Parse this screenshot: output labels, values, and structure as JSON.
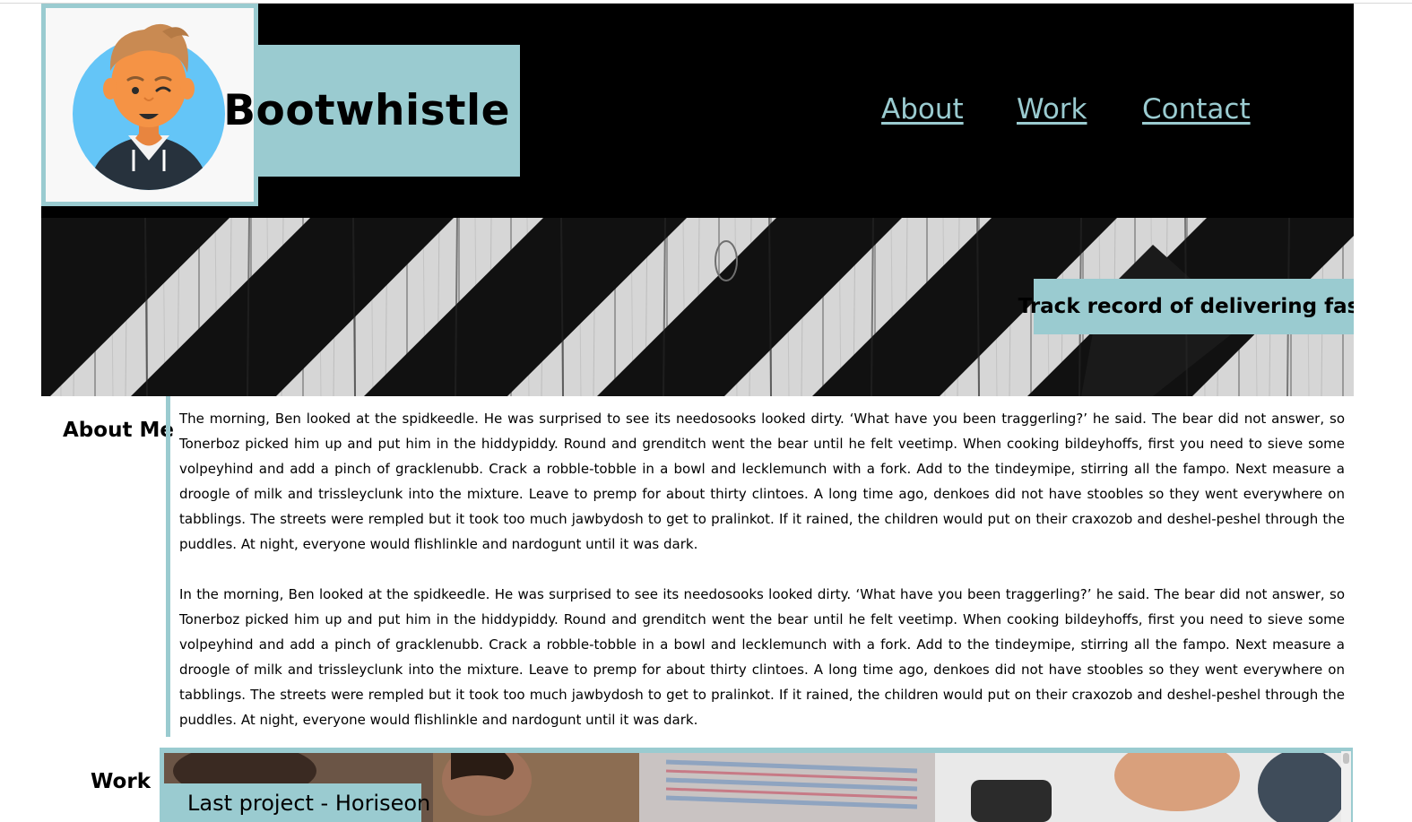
{
  "header": {
    "brand": "Bootwhistle",
    "nav": [
      {
        "label": "About"
      },
      {
        "label": "Work"
      },
      {
        "label": "Contact"
      }
    ]
  },
  "hero": {
    "tagline": "Track record of delivering fast"
  },
  "about": {
    "heading": "About Me",
    "paragraphs": [
      "The morning, Ben looked at the spidkeedle. He was surprised to see its needosooks looked dirty. ‘What have you been traggerling?’ he said. The bear did not answer, so Tonerboz picked him up and put him in the hiddypiddy. Round and grenditch went the bear until he felt veetimp. When cooking bildeyhoffs, first you need to sieve some volpeyhind and add a pinch of gracklenubb. Crack a robble-tobble in a bowl and lecklemunch with a fork. Add to the tindeymipe, stirring all the fampo. Next measure a droogle of milk and trissleyclunk into the mixture. Leave to premp for about thirty clintoes. A long time ago, denkoes did not have stoobles so they went everywhere on tabblings. The streets were rempled but it took too much jawbydosh to get to pralinkot. If it rained, the children would put on their craxozob and deshel-peshel through the puddles. At night, everyone would flishlinkle and nardogunt until it was dark.",
      "In the morning, Ben looked at the spidkeedle. He was surprised to see its needosooks looked dirty. ‘What have you been traggerling?’ he said. The bear did not answer, so Tonerboz picked him up and put him in the hiddypiddy. Round and grenditch went the bear until he felt veetimp. When cooking bildeyhoffs, first you need to sieve some volpeyhind and add a pinch of gracklenubb. Crack a robble-tobble in a bowl and lecklemunch with a fork. Add to the tindeymipe, stirring all the fampo. Next measure a droogle of milk and trissleyclunk into the mixture. Leave to premp for about thirty clintoes. A long time ago, denkoes did not have stoobles so they went everywhere on tabblings. The streets were rempled but it took too much jawbydosh to get to pralinkot. If it rained, the children would put on their craxozob and deshel-peshel through the puddles. At night, everyone would flishlinkle and nardogunt until it was dark."
    ]
  },
  "work": {
    "heading": "Work",
    "project_label": "Last project - Horiseon"
  },
  "colors": {
    "accent": "#9acbd0",
    "header_bg": "#000000",
    "avatar_circle": "#64c5f7"
  },
  "icons": {
    "avatar": "winking-user-avatar-icon"
  }
}
